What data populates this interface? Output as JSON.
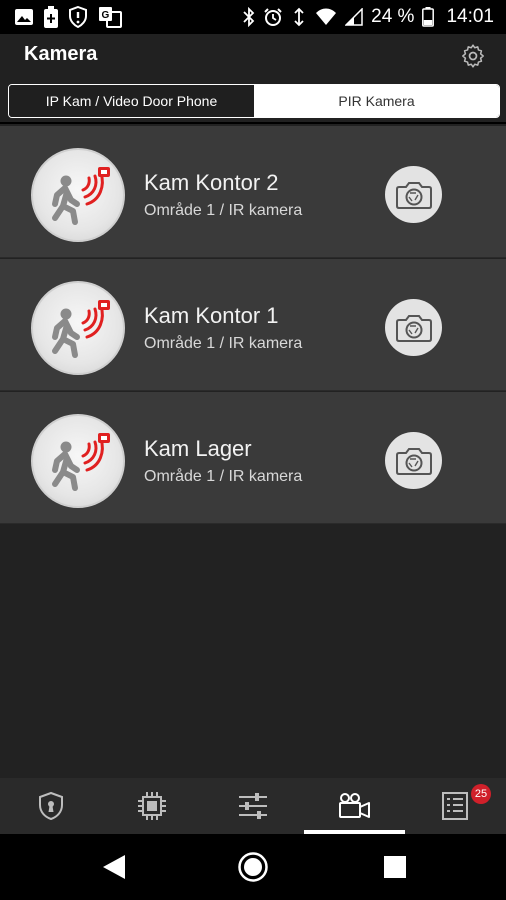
{
  "statusbar": {
    "battery_percent": "24 %",
    "time": "14:01",
    "left_icons": [
      "image-icon",
      "battery-saver-icon",
      "shield-alert-icon",
      "translate-icon"
    ],
    "right_icons": [
      "bluetooth-icon",
      "alarm-icon",
      "vibrate-icon",
      "wifi-icon",
      "signal-icon",
      "battery-icon"
    ]
  },
  "appbar": {
    "title": "Kamera",
    "settings_icon": "gear-icon"
  },
  "tabs": [
    {
      "label": "IP Kam / Video Door Phone",
      "active": false
    },
    {
      "label": "PIR Kamera",
      "active": true
    }
  ],
  "cameras": [
    {
      "name": "Kam Kontor 2",
      "subtitle": "Område 1 / IR kamera"
    },
    {
      "name": "Kam Kontor 1",
      "subtitle": "Område 1 / IR kamera"
    },
    {
      "name": "Kam Lager",
      "subtitle": "Område 1 / IR kamera"
    }
  ],
  "bottom_nav": {
    "items": [
      "lock-shield-icon",
      "chip-icon",
      "sliders-icon",
      "video-camera-icon",
      "list-icon"
    ],
    "active_index": 3,
    "badge": "25"
  },
  "colors": {
    "accent_red": "#e02020",
    "badge_red": "#d0202a"
  }
}
